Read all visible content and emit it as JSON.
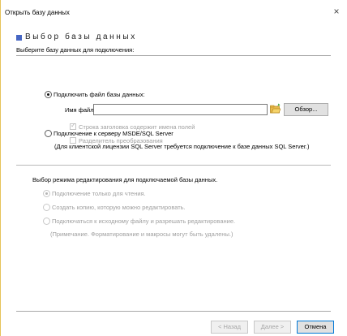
{
  "window": {
    "title": "Открыть базу данных",
    "close_glyph": "×"
  },
  "header": {
    "title": "Выбор базы данных",
    "subtitle": "Выберите базу данных для подключения:",
    "accent_color": "#4666c3"
  },
  "connect_file": {
    "radio_label": "Подключить файл базы данных:",
    "selected": true,
    "file_name_label": "Имя файла:",
    "file_name_value": "",
    "browse_label": "Обзор...",
    "options": [
      {
        "label": "Строка заголовка содержит имена полей",
        "checked": true,
        "enabled": false
      },
      {
        "label": "Разделитель преобразования",
        "checked": false,
        "enabled": false
      }
    ]
  },
  "connect_server": {
    "radio_label": "Подключение к серверу MSDE/SQL Server",
    "selected": false,
    "note": "(Для клиентской лицензии SQL Server требуется подключение к базе данных SQL Server.)"
  },
  "edit_mode": {
    "heading": "Выбор режима редактирования для подключаемой базы данных.",
    "options": [
      {
        "label": "Подключение только для чтения.",
        "selected": true,
        "enabled": false
      },
      {
        "label": "Создать копию, которую можно редактировать.",
        "selected": false,
        "enabled": false
      },
      {
        "label": "Подключаться к исходному файлу и разрешать редактирование.",
        "selected": false,
        "enabled": false
      }
    ],
    "note": "(Примечание. Форматирование и макросы могут быть удалены.)"
  },
  "footer": {
    "back_label": "< Назад",
    "next_label": "Далее >",
    "cancel_label": "Отмена"
  }
}
